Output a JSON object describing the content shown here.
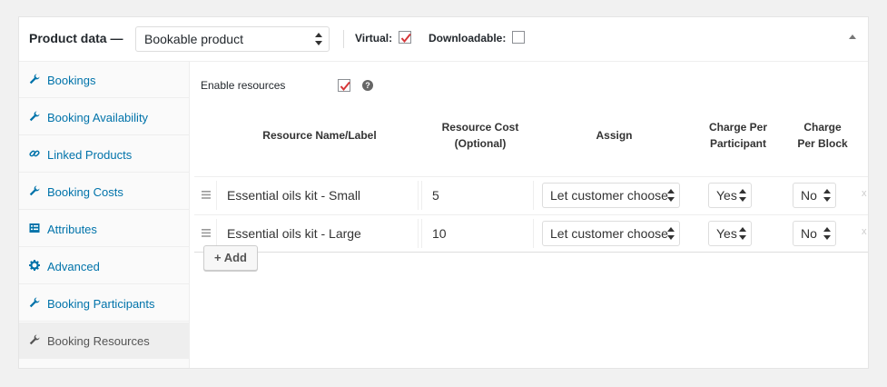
{
  "header": {
    "title": "Product data —",
    "product_type": "Bookable product",
    "virtual_label": "Virtual:",
    "virtual_checked": true,
    "downloadable_label": "Downloadable:",
    "downloadable_checked": false
  },
  "sidebar": {
    "items": [
      {
        "label": "Bookings",
        "icon": "wrench-icon"
      },
      {
        "label": "Booking Availability",
        "icon": "wrench-icon"
      },
      {
        "label": "Linked Products",
        "icon": "link-icon"
      },
      {
        "label": "Booking Costs",
        "icon": "wrench-icon"
      },
      {
        "label": "Attributes",
        "icon": "list-icon"
      },
      {
        "label": "Advanced",
        "icon": "gear-icon"
      },
      {
        "label": "Booking Participants",
        "icon": "wrench-icon"
      },
      {
        "label": "Booking Resources",
        "icon": "wrench-icon",
        "active": true
      }
    ]
  },
  "main": {
    "enable_resources_label": "Enable resources",
    "enable_resources_checked": true,
    "help_icon": "help-icon",
    "columns": {
      "name": "Resource Name/Label",
      "cost_line1": "Resource Cost",
      "cost_line2": "(Optional)",
      "assign": "Assign",
      "participant_line1": "Charge Per",
      "participant_line2": "Participant",
      "block_line1": "Charge",
      "block_line2": "Per Block"
    },
    "rows": [
      {
        "name": "Essential oils kit - Small",
        "cost": "5",
        "assign": "Let customer choose",
        "per_participant": "Yes",
        "per_block": "No",
        "remove": "x"
      },
      {
        "name": "Essential oils kit - Large",
        "cost": "10",
        "assign": "Let customer choose",
        "per_participant": "Yes",
        "per_block": "No",
        "remove": "x"
      }
    ],
    "add_button": "+ Add"
  },
  "colors": {
    "link": "#0073aa",
    "checkmark": "#d63638",
    "border": "#dddddd"
  }
}
